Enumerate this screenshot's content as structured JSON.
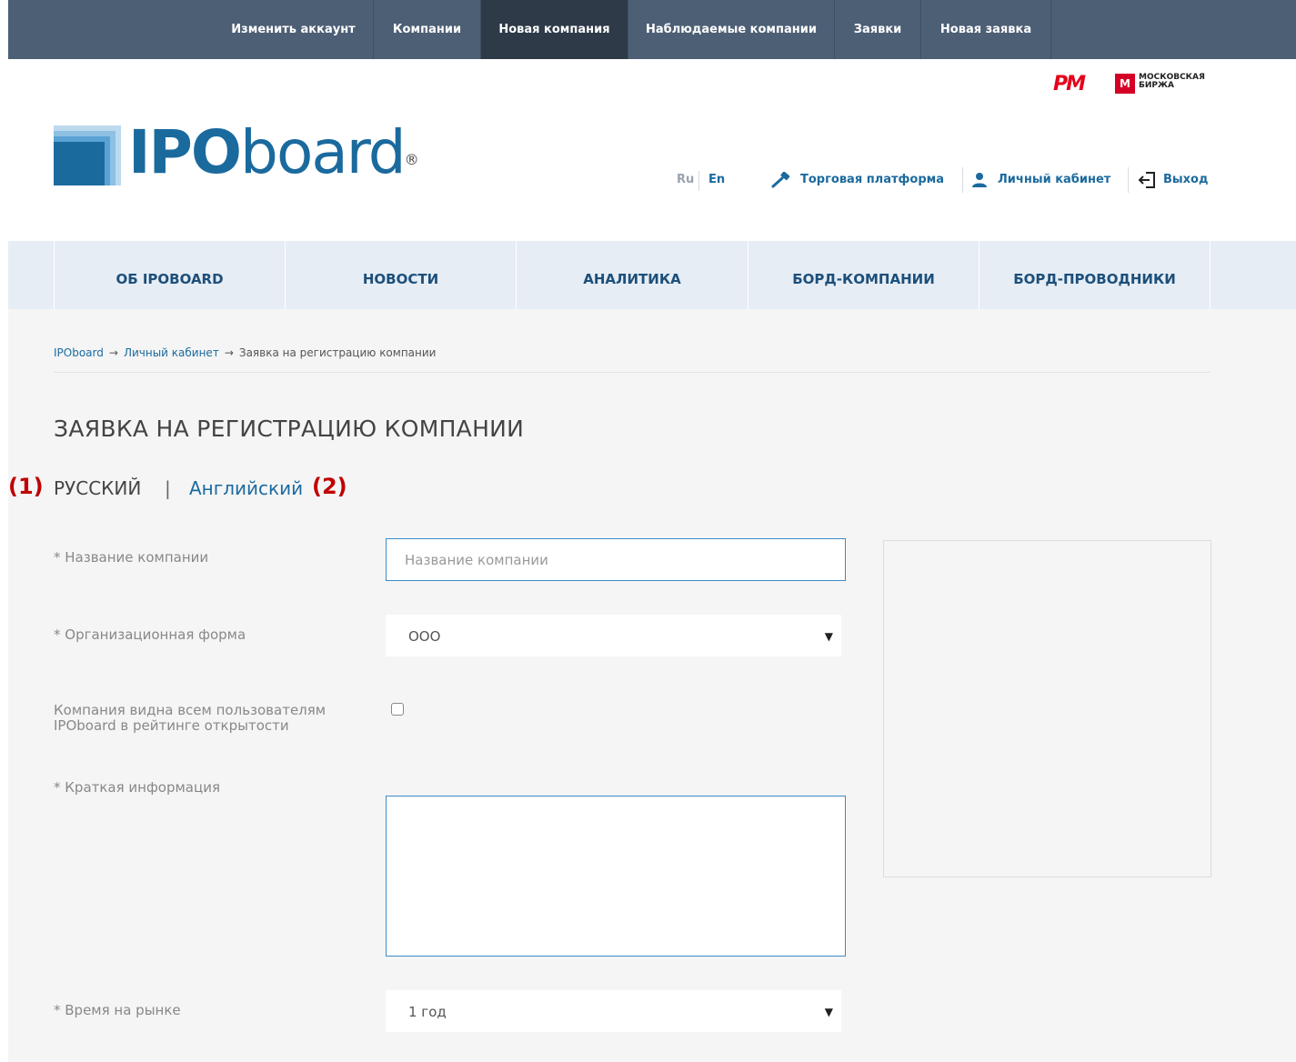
{
  "admin_bar": {
    "items": [
      {
        "label": "Изменить аккаунт"
      },
      {
        "label": "Компании"
      },
      {
        "label": "Новая компания"
      },
      {
        "label": "Наблюдаемые компании"
      },
      {
        "label": "Заявки"
      },
      {
        "label": "Новая заявка"
      }
    ],
    "active_index": 2
  },
  "partners": {
    "pm_logo_text": "PM",
    "moex_mark": "M",
    "moex_line1": "МОСКОВСКАЯ",
    "moex_line2": "БИРЖА"
  },
  "logo": {
    "bold": "IPO",
    "rest": "board",
    "reg": "®"
  },
  "header": {
    "lang_ru": "Ru",
    "lang_en": "En",
    "trading_platform": "Торговая платформа",
    "personal_account": "Личный кабинет",
    "logout": "Выход"
  },
  "main_nav": {
    "items": [
      {
        "label": "ОБ IPOBOARD"
      },
      {
        "label": "НОВОСТИ"
      },
      {
        "label": "АНАЛИТИКА"
      },
      {
        "label": "БОРД-КОМПАНИИ"
      },
      {
        "label": "БОРД-ПРОВОДНИКИ"
      }
    ]
  },
  "breadcrumb": {
    "home": "IPOboard",
    "arrow": "→",
    "account": "Личный кабинет",
    "current": "Заявка на регистрацию компании"
  },
  "page_title": "ЗАЯВКА НА РЕГИСТРАЦИЮ КОМПАНИИ",
  "language_tabs": {
    "marker1": "(1)",
    "russian": "РУССКИЙ",
    "separator": "|",
    "english": "Английский",
    "marker2": "(2)"
  },
  "form": {
    "company_name_label": "* Название компании",
    "company_name_placeholder": "Название компании",
    "org_form_label": "* Организационная форма",
    "org_form_value": "ООО",
    "visibility_label_line1": "Компания видна всем пользователям",
    "visibility_label_line2": "IPOboard в рейтинге открытости",
    "short_info_label": "* Краткая информация",
    "market_time_label": "* Время на рынке",
    "market_time_value": "1 год",
    "dropdown_arrow": "▼"
  },
  "colors": {
    "admin_bar": "#4d5f75",
    "admin_active": "#2e3a48",
    "brand_blue": "#1b6a9e",
    "nav_bg": "#e6edf5",
    "marker_red": "#c00000"
  }
}
